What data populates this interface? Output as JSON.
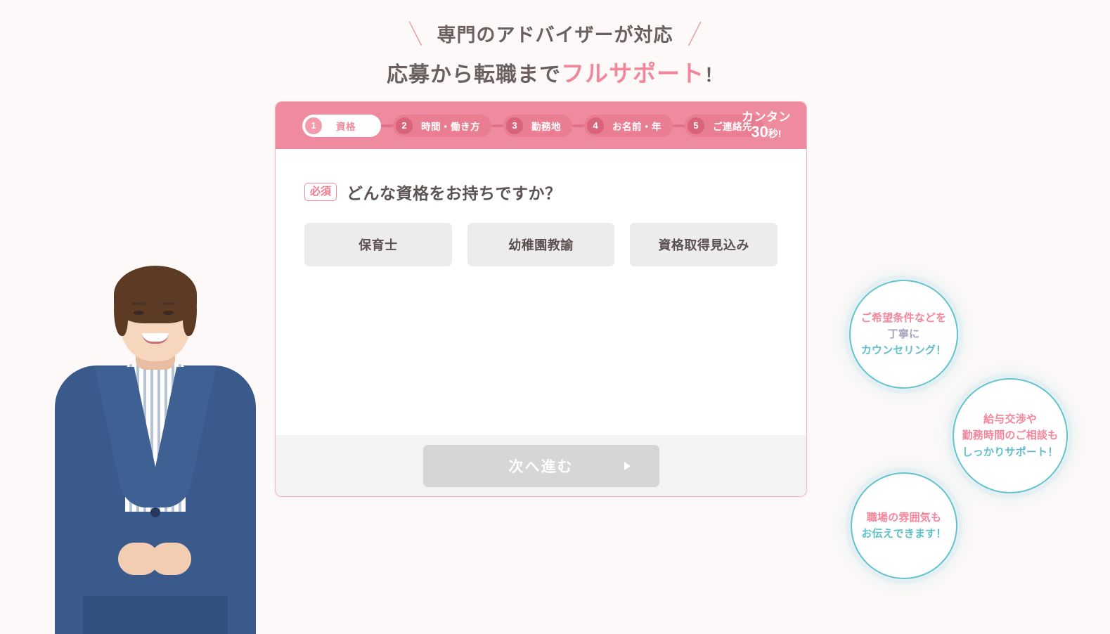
{
  "headline": {
    "line1": "専門のアドバイザーが対応",
    "slash_left": "＼",
    "slash_right": "／",
    "line2_prefix": "応募から転職まで",
    "line2_accent": "フルサポート",
    "line2_suffix": "！"
  },
  "form": {
    "steps": [
      {
        "num": "1",
        "label": "資格",
        "active": true
      },
      {
        "num": "2",
        "label": "時間・働き方",
        "active": false
      },
      {
        "num": "3",
        "label": "勤務地",
        "active": false
      },
      {
        "num": "4",
        "label": "お名前・年",
        "active": false
      },
      {
        "num": "5",
        "label": "ご連絡先",
        "active": false
      }
    ],
    "easy_badge": {
      "line1": "カンタン",
      "number": "30",
      "unit": "秒!"
    },
    "required_badge": "必須",
    "question": "どんな資格をお持ちですか？",
    "options": [
      {
        "label": "保育士"
      },
      {
        "label": "幼稚園教諭"
      },
      {
        "label": "資格取得見込み"
      }
    ],
    "submit_label": "次へ進む"
  },
  "bubbles": [
    {
      "id": "counsel",
      "lines": [
        "ご希望条件などを",
        "丁寧に",
        "カウンセリング！"
      ]
    },
    {
      "id": "nego",
      "lines": [
        "給与交渉や",
        "勤務時間のご相談も",
        "しっかりサポート！"
      ]
    },
    {
      "id": "mood",
      "lines": [
        "職場の雰囲気も",
        "お伝えできます！"
      ]
    }
  ],
  "colors": {
    "page_background": "#fdf9f8",
    "brand_pink": "#ef8b9e",
    "accent_pink": "#f2879c",
    "card_border": "#f3b3bf",
    "bubble_teal": "#63c3cd",
    "option_grey": "#ececec",
    "submit_grey": "#d6d6d6",
    "footer_grey": "#f3f3f3",
    "text_dark": "#5c5353",
    "suit_navy": "#3a5a8c"
  }
}
